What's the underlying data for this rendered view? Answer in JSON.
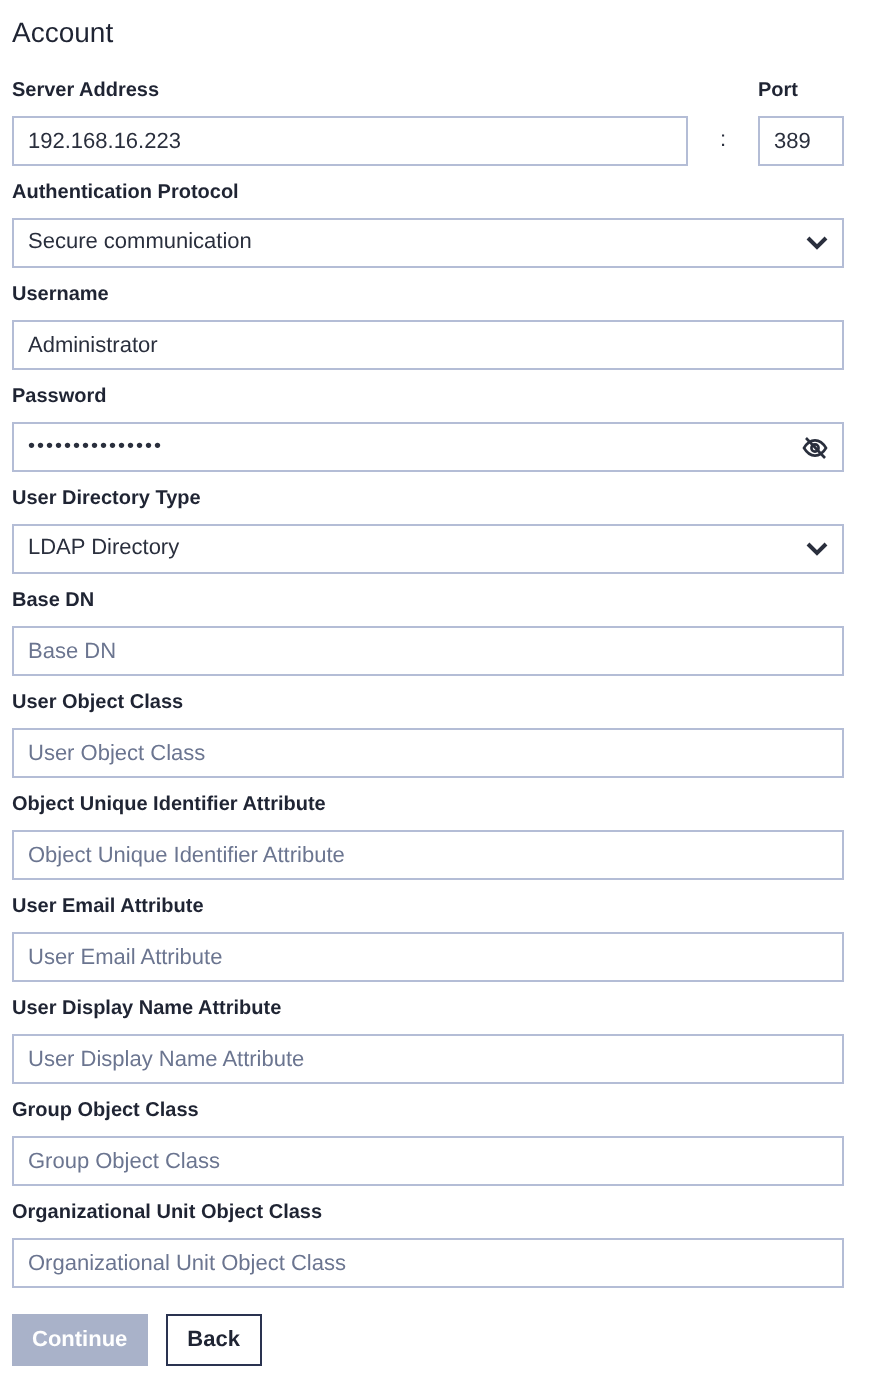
{
  "title": "Account",
  "server": {
    "label": "Server Address",
    "value": "192.168.16.223",
    "separator": ":",
    "port_label": "Port",
    "port_value": "389"
  },
  "fields": [
    {
      "kind": "select",
      "label": "Authentication Protocol",
      "value": "Secure communication"
    },
    {
      "kind": "text",
      "label": "Username",
      "value": "Administrator"
    },
    {
      "kind": "password",
      "label": "Password",
      "value": "•••••••••••••••"
    },
    {
      "kind": "select",
      "label": "User Directory Type",
      "value": "LDAP Directory"
    },
    {
      "kind": "text",
      "label": "Base DN",
      "placeholder": "Base DN"
    },
    {
      "kind": "text",
      "label": "User Object Class",
      "placeholder": "User Object Class"
    },
    {
      "kind": "text",
      "label": "Object Unique Identifier Attribute",
      "placeholder": "Object Unique Identifier Attribute"
    },
    {
      "kind": "text",
      "label": "User Email Attribute",
      "placeholder": "User Email Attribute"
    },
    {
      "kind": "text",
      "label": "User Display Name Attribute",
      "placeholder": "User Display Name Attribute"
    },
    {
      "kind": "text",
      "label": "Group Object Class",
      "placeholder": "Group Object Class"
    },
    {
      "kind": "text",
      "label": "Organizational Unit Object Class",
      "placeholder": "Organizational Unit Object Class"
    }
  ],
  "buttons": [
    {
      "label": "Continue",
      "disabled": true
    },
    {
      "label": "Back",
      "disabled": false
    }
  ]
}
